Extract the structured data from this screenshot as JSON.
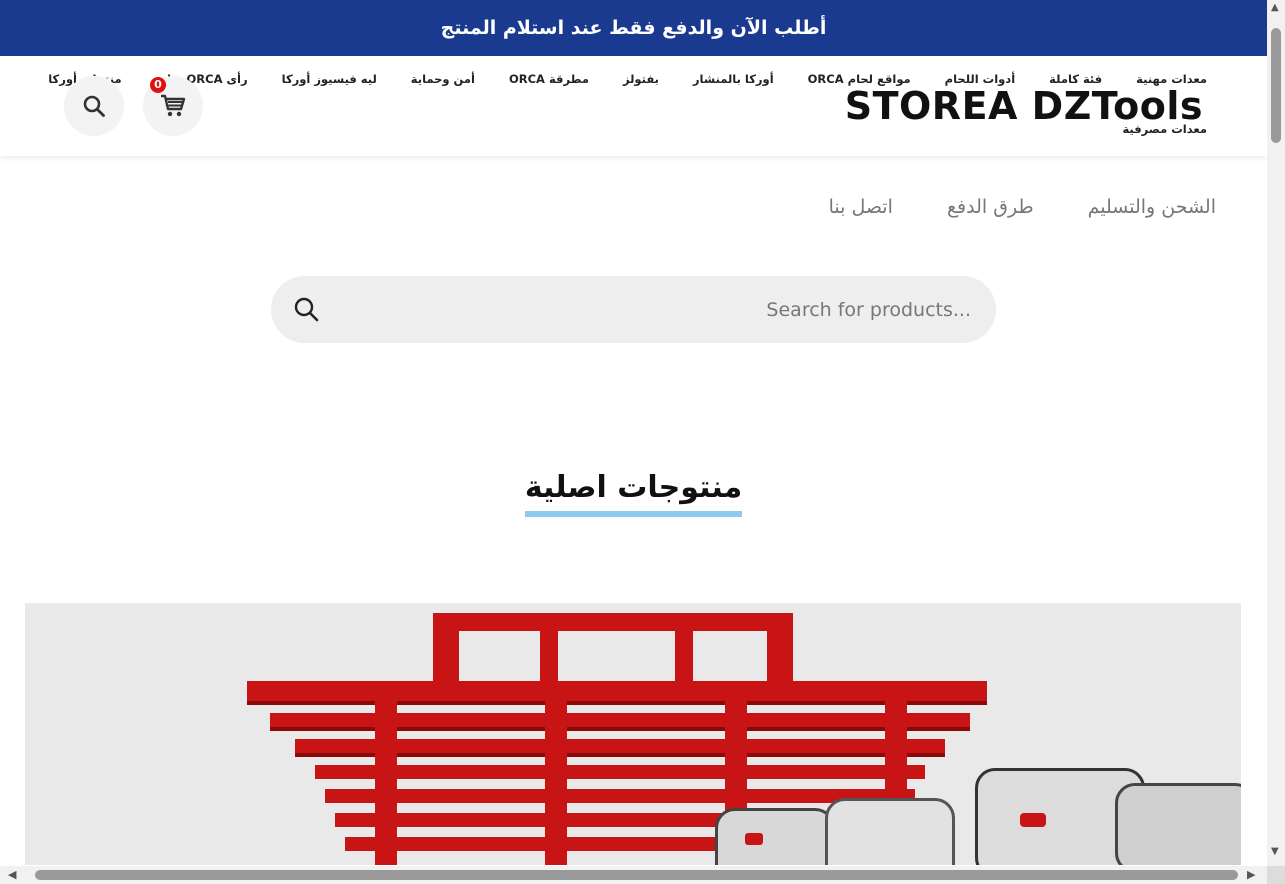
{
  "topbar": {
    "text": "أطلب الآن والدفع فقط عند استلام المنتج"
  },
  "header": {
    "logo": "STOREA DZTools",
    "nav_items": [
      "معدات مهنية",
      "فئة كاملة",
      "أدوات اللحام",
      "مواقع لحام ORCA",
      "أوركا بالمنشار",
      "بفتولز",
      "مطرقة ORCA",
      "أمن وحماية",
      "ليه فيسيوز أوركا",
      "رأى ORCA صابر",
      "منتجات أوركا"
    ],
    "nav_row2": "معدات مصرفية",
    "cart_count": "0",
    "icons": {
      "search": "search-icon",
      "cart": "cart-icon"
    }
  },
  "subnav": {
    "items": [
      "الشحن والتسليم",
      "طرق الدفع",
      "اتصل بنا"
    ]
  },
  "search": {
    "placeholder": "Search for products..."
  },
  "section": {
    "title": "منتوجات اصلية"
  },
  "hero": {
    "image": "red-pallet-and-power-tools"
  },
  "colors": {
    "topbar": "#1a3a8f",
    "accent_underline": "#8ec9ee",
    "badge": "#e01010",
    "pallet": "#c81414"
  }
}
